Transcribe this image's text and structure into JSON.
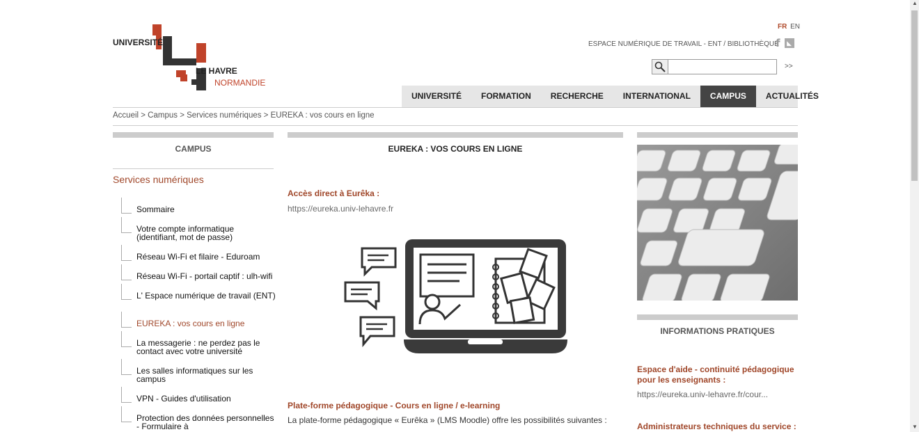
{
  "logo": {
    "line1": "UNIVERSITÉ",
    "line2": "LE HAVRE",
    "line3": "NORMANDIE"
  },
  "lang": {
    "fr": "FR",
    "en": "EN"
  },
  "toplinks": "ESPACE NUMÉRIQUE DE TRAVAIL - ENT / BIBLIOTHÈQUE",
  "search": {
    "value": "",
    "go": ">>"
  },
  "nav": [
    "UNIVERSITÉ",
    "FORMATION",
    "RECHERCHE",
    "INTERNATIONAL",
    "CAMPUS",
    "ACTUALITÉS"
  ],
  "breadcrumb": "Accueil > Campus > Services numériques > EUREKA : vos cours en ligne",
  "left": {
    "title": "CAMPUS",
    "section": "Services numériques",
    "items": [
      "Sommaire",
      "Votre compte informatique (identifiant, mot de passe)",
      "Réseau Wi-Fi et filaire - Eduroam",
      "Réseau Wi-Fi - portail captif : ulh-wifi",
      "L' Espace numérique de travail (ENT)",
      "EUREKA : vos cours en ligne",
      "La messagerie : ne perdez pas le contact avec votre université",
      "Les salles informatiques sur les campus",
      "VPN - Guides d'utilisation",
      "Protection des données personnelles - Formulaire à"
    ]
  },
  "main": {
    "title": "EUREKA : VOS COURS EN LIGNE",
    "direct_label": "Accès direct à Eurêka :",
    "direct_url": "https://eureka.univ-lehavre.fr",
    "platform_title": "Plate-forme pédagogique - Cours en ligne / e-learning",
    "platform_text": "La plate-forme pédagogique « Eurêka » (LMS Moodle) offre les possibilités suivantes :"
  },
  "right": {
    "title": "INFORMATIONS PRATIQUES",
    "help_title": "Espace d'aide - continuité pédagogique pour les enseignants :",
    "help_url": "https://eureka.univ-lehavre.fr/cour...",
    "admin_title": "Administrateurs techniques du service :"
  },
  "colors": {
    "accent": "#a0472a",
    "nav_active": "#444444",
    "bar": "#cccccc"
  }
}
